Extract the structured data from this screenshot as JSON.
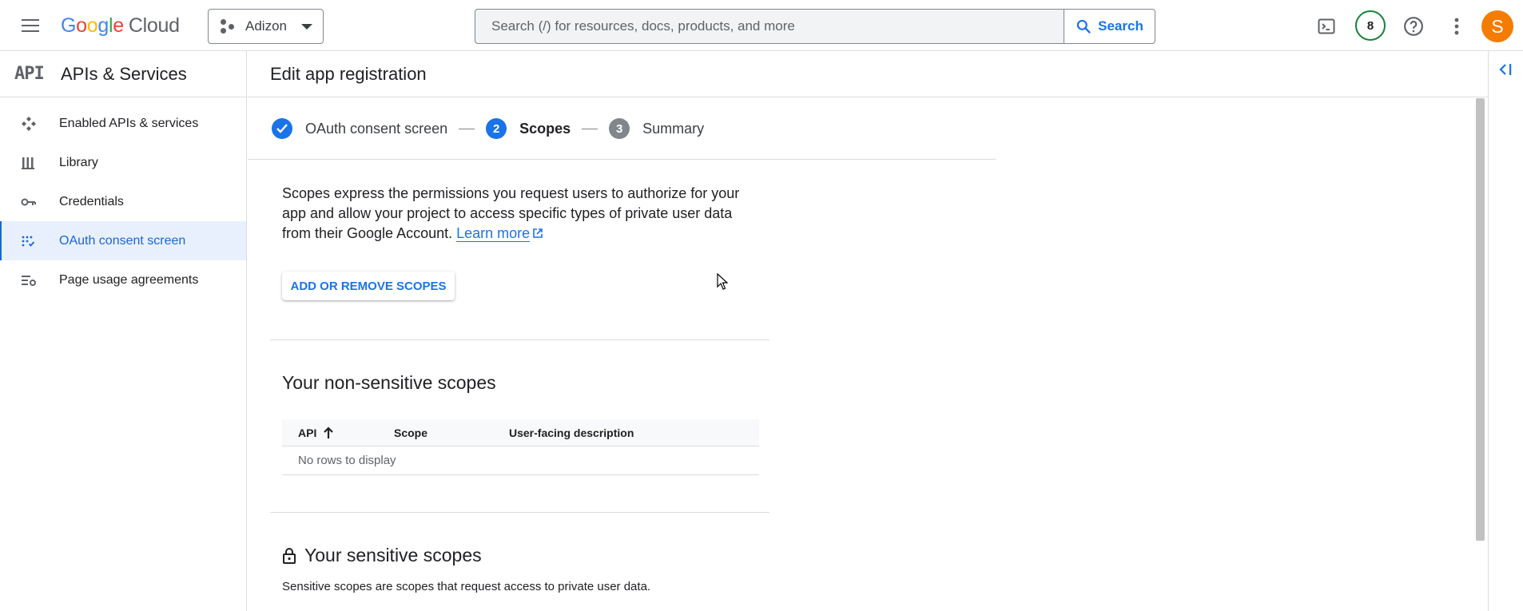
{
  "header": {
    "logo_text": "Google",
    "logo_product": "Cloud",
    "project": "Adizon",
    "search_placeholder": "Search (/) for resources, docs, products, and more",
    "search_button": "Search",
    "notifications_count": "8",
    "avatar_letter": "S"
  },
  "sidebar": {
    "logo": "API",
    "title": "APIs & Services",
    "items": [
      {
        "label": "Enabled APIs & services",
        "icon": "services-icon"
      },
      {
        "label": "Library",
        "icon": "library-icon"
      },
      {
        "label": "Credentials",
        "icon": "key-icon"
      },
      {
        "label": "OAuth consent screen",
        "icon": "consent-icon",
        "active": true
      },
      {
        "label": "Page usage agreements",
        "icon": "settings-list-icon"
      }
    ]
  },
  "main": {
    "title": "Edit app registration",
    "steps": [
      {
        "label": "OAuth consent screen",
        "state": "done"
      },
      {
        "number": "2",
        "label": "Scopes",
        "state": "current"
      },
      {
        "number": "3",
        "label": "Summary",
        "state": "todo"
      }
    ],
    "description": "Scopes express the permissions you request users to authorize for your app and allow your project to access specific types of private user data from their Google Account.",
    "learn_more": "Learn more",
    "add_scopes_button": "ADD OR REMOVE SCOPES",
    "nonsensitive_title": "Your non-sensitive scopes",
    "table": {
      "columns": [
        "API",
        "Scope",
        "User-facing description"
      ],
      "empty": "No rows to display"
    },
    "sensitive_title": "Your sensitive scopes",
    "sensitive_desc": "Sensitive scopes are scopes that request access to private user data."
  },
  "colors": {
    "accent": "#1a73e8",
    "active_bg": "#e8f0fe",
    "avatar": "#f57c00",
    "badge_ring": "#188038"
  }
}
